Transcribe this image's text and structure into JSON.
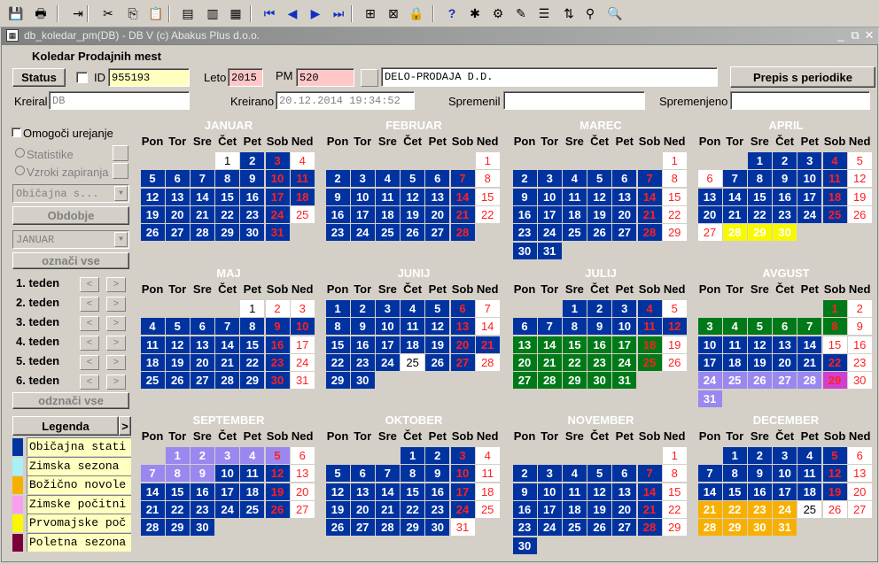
{
  "app": {
    "title": "db_koledar_pm(DB) - DB V (c) Abakus Plus d.o.o."
  },
  "toolbar": {
    "icons": [
      "save-icon",
      "print-icon",
      "exit-icon",
      "cut-icon",
      "copy-icon",
      "paste-icon",
      "query-icon",
      "execute-query-icon",
      "cancel-query-icon",
      "first-record-icon",
      "previous-record-icon",
      "next-record-icon",
      "last-record-icon",
      "insert-record-icon",
      "delete-record-icon",
      "lock-record-icon",
      "help-icon",
      "debug-icon",
      "tool-icon",
      "edit-icon",
      "list-icon",
      "sort-icon",
      "filter-icon",
      "zoom-icon"
    ]
  },
  "form": {
    "title": "Koledar Prodajnih mest",
    "status_label": "Status",
    "id_label": "ID",
    "id_value": "955193",
    "leto_label": "Leto",
    "leto_value": "2015",
    "pm_label": "PM",
    "pm_value": "520",
    "company_value": "DELO-PRODAJA D.D.",
    "prepis_label": "Prepis s periodike",
    "kreiral_label": "Kreiral",
    "kreiral_value": "DB",
    "kreirano_label": "Kreirano",
    "kreirano_value": "20.12.2014 19:34:52",
    "spremenil_label": "Spremenil",
    "spremenil_value": "",
    "spremenjeno_label": "Spremenjeno",
    "spremenjeno_value": ""
  },
  "side": {
    "omogoci": "Omogoči urejanje",
    "statistike": "Statistike",
    "vzroki": "Vzroki zapiranja",
    "sezona_select": "Običajna s...",
    "obdobje_label": "Obdobje",
    "month_select": "JANUAR",
    "oznaci_vse": "označi vse",
    "weeks": [
      "1. teden",
      "2. teden",
      "3. teden",
      "4. teden",
      "5. teden",
      "6. teden"
    ],
    "odznaci_vse": "odznači vse",
    "prev": "<",
    "next": ">"
  },
  "legend": {
    "title": "Legenda",
    "arrow": ">",
    "items": [
      {
        "label": "Običajna stati",
        "color": "#0033a0"
      },
      {
        "label": "Zimska sezona",
        "color": "#a8f0f8"
      },
      {
        "label": "Božično novole",
        "color": "#f8b000"
      },
      {
        "label": "Zimske počitni",
        "color": "#f8a0f0"
      },
      {
        "label": "Prvomajske poč",
        "color": "#f8f800"
      },
      {
        "label": "Poletna sezona",
        "color": "#7a003a"
      }
    ]
  },
  "colors": {
    "normal": "#0033a0",
    "weekend_text": "#ff2020",
    "inactive_bg": "#ffffff",
    "green": "#007a18",
    "lavender": "#9a88f0",
    "yellow": "#f8f800",
    "orange": "#f8b000",
    "magenta": "#d040d0"
  },
  "weekdays": [
    "Pon",
    "Tor",
    "Sre",
    "Čet",
    "Pet",
    "Sob",
    "Ned"
  ],
  "months": [
    {
      "name": "JANUAR",
      "start": 3,
      "days": 31,
      "inactive": [
        1,
        4,
        25
      ],
      "special": {}
    },
    {
      "name": "FEBRUAR",
      "start": 6,
      "days": 28,
      "inactive": [
        1,
        8,
        15,
        22
      ],
      "special": {}
    },
    {
      "name": "MAREC",
      "start": 6,
      "days": 31,
      "inactive": [
        1,
        8,
        15,
        22,
        29
      ],
      "special": {}
    },
    {
      "name": "APRIL",
      "start": 2,
      "days": 30,
      "inactive": [
        5,
        6,
        12,
        19,
        26,
        27
      ],
      "special": {
        "28": "yellow",
        "29": "yellow",
        "30": "yellow"
      }
    },
    {
      "name": "MAJ",
      "start": 4,
      "days": 31,
      "inactive": [
        1,
        2,
        3,
        17,
        24,
        31
      ],
      "special": {}
    },
    {
      "name": "JUNIJ",
      "start": 0,
      "days": 30,
      "inactive": [
        7,
        14,
        25,
        28
      ],
      "special": {}
    },
    {
      "name": "JULIJ",
      "start": 2,
      "days": 31,
      "inactive": [
        5,
        19,
        26
      ],
      "special": {
        "13": "green",
        "14": "green",
        "15": "green",
        "16": "green",
        "17": "green",
        "18": "green",
        "20": "green",
        "21": "green",
        "22": "green",
        "23": "green",
        "24": "green",
        "25": "green",
        "27": "green",
        "28": "green",
        "29": "green",
        "30": "green",
        "31": "green"
      }
    },
    {
      "name": "AVGUST",
      "start": 5,
      "days": 31,
      "inactive": [
        2,
        9,
        15,
        16,
        23,
        30
      ],
      "special": {
        "1": "green",
        "3": "green",
        "4": "green",
        "5": "green",
        "6": "green",
        "7": "green",
        "8": "green",
        "24": "lavender",
        "25": "lavender",
        "26": "lavender",
        "27": "lavender",
        "28": "lavender",
        "29": "magenta",
        "31": "lavender"
      }
    },
    {
      "name": "SEPTEMBER",
      "start": 1,
      "days": 30,
      "inactive": [
        6,
        13,
        20,
        27
      ],
      "special": {
        "1": "lavender",
        "2": "lavender",
        "3": "lavender",
        "4": "lavender",
        "5": "lavender",
        "7": "lavender",
        "8": "lavender",
        "9": "lavender"
      }
    },
    {
      "name": "OKTOBER",
      "start": 3,
      "days": 31,
      "inactive": [
        4,
        11,
        18,
        25,
        31
      ],
      "special": {}
    },
    {
      "name": "NOVEMBER",
      "start": 6,
      "days": 30,
      "inactive": [
        1,
        8,
        15,
        22,
        29
      ],
      "special": {}
    },
    {
      "name": "DECEMBER",
      "start": 1,
      "days": 31,
      "inactive": [
        6,
        13,
        20,
        25,
        26,
        27
      ],
      "special": {
        "21": "orange",
        "22": "orange",
        "23": "orange",
        "24": "orange",
        "28": "orange",
        "29": "orange",
        "30": "orange",
        "31": "orange"
      }
    }
  ]
}
